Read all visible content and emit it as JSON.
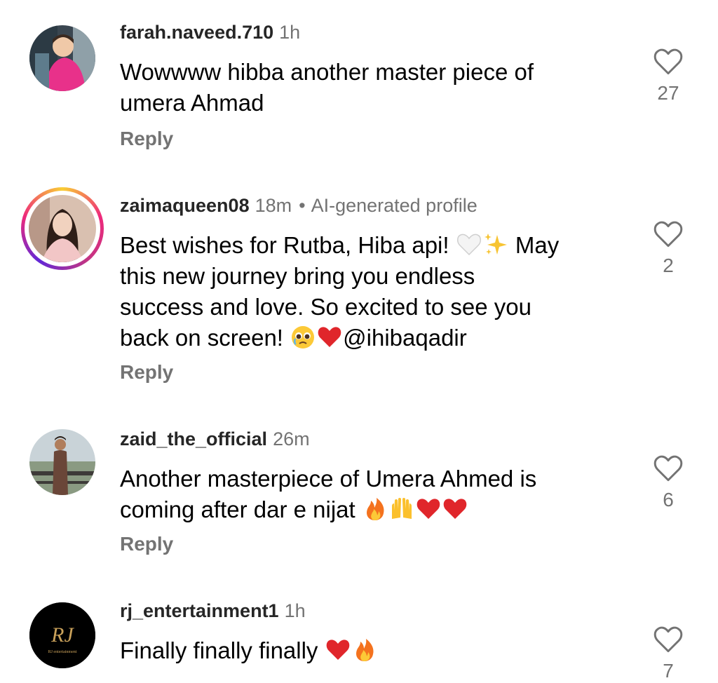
{
  "comments": [
    {
      "username": "farah.naveed.710",
      "time": "1h",
      "lines": [
        "Wowwww hibba another master piece of",
        "umera Ahmad"
      ],
      "reply_label": "Reply",
      "like_count": "27"
    },
    {
      "username": "zaimaqueen08",
      "time": "18m",
      "separator": "•",
      "ai_label": "AI-generated profile",
      "line1_a": "Best wishes for Rutba, Hiba api!",
      "line1_b": "May",
      "line2": "this new journey bring you endless",
      "line3": "success and love. So excited to see you",
      "line4_a": "back on screen!",
      "line4_b": "@ihibaqadir",
      "reply_label": "Reply",
      "like_count": "2"
    },
    {
      "username": "zaid_the_official",
      "time": "26m",
      "line1": "Another masterpiece of Umera Ahmed is",
      "line2": "coming after dar e nijat",
      "reply_label": "Reply",
      "like_count": "6"
    },
    {
      "username": "rj_entertainment1",
      "time": "1h",
      "line1": "Finally finally finally",
      "like_count": "7",
      "logo_text": "RJ",
      "logo_subtext": "RJ entertainment"
    }
  ],
  "icons": {
    "like": "heart-outline-icon",
    "white_heart": "white-heart-emoji",
    "sparkles": "sparkles-emoji",
    "pleading": "pleading-face-emoji",
    "red_heart": "red-heart-emoji",
    "fire": "fire-emoji",
    "raised_hands": "raised-hands-emoji"
  },
  "colors": {
    "text_primary": "#000000",
    "username": "#262626",
    "secondary": "#737373",
    "story_ring": [
      "#f9ce34",
      "#ee2a7b",
      "#6228d7"
    ]
  }
}
